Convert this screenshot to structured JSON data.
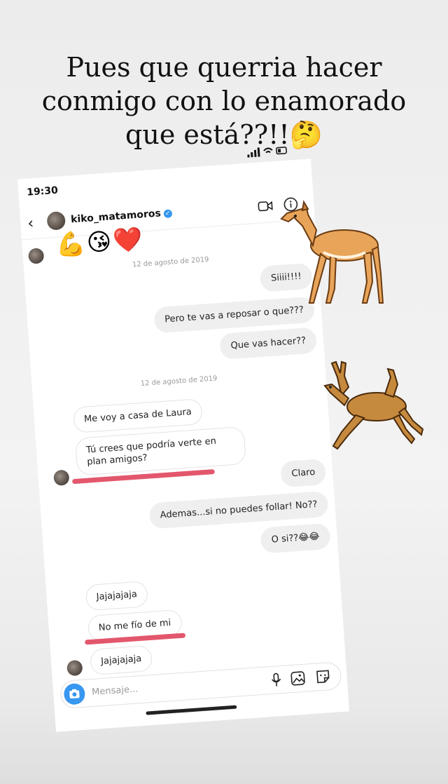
{
  "caption": {
    "line1": "Pues que querria hacer",
    "line2": "conmigo con lo enamorado",
    "line3": "que está??!!",
    "emoji": "🤔"
  },
  "status_bar": {
    "time": "19:30"
  },
  "chat_header": {
    "username": "kiko_matamoros",
    "verified_icon": "✓"
  },
  "top_emojis": "💪😘❤️",
  "date_labels": [
    "12 de agosto de 2019",
    "12 de agosto de 2019"
  ],
  "messages": [
    {
      "text": "Siiii!!!!",
      "direction": "outgoing"
    },
    {
      "text": "Pero te vas a reposar o que???",
      "direction": "outgoing"
    },
    {
      "text": "Que vas hacer??",
      "direction": "outgoing"
    },
    {
      "text": "Me voy a casa de Laura",
      "direction": "incoming"
    },
    {
      "text": "Tú crees que podría verte en plan amigos?",
      "direction": "incoming",
      "highlighted": true
    },
    {
      "text": "Claro",
      "direction": "outgoing"
    },
    {
      "text": "Ademas...si no puedes follar!  No??",
      "direction": "outgoing"
    },
    {
      "text": "O si??😂😂",
      "direction": "outgoing"
    },
    {
      "text": "Jajajajaja",
      "direction": "incoming"
    },
    {
      "text": "No me fío de mi",
      "direction": "incoming",
      "highlighted": true
    },
    {
      "text": "Jajajajaja",
      "direction": "incoming"
    }
  ],
  "composer": {
    "placeholder": "Mensaje..."
  },
  "icons": [
    "back-icon",
    "verified-icon",
    "video-call-icon",
    "info-icon",
    "camera-icon",
    "microphone-icon",
    "gallery-icon",
    "sticker-icon",
    "deer-sticker"
  ],
  "colors": {
    "highlight": "#e0455d",
    "accent": "#3897f0",
    "outgoing_bubble": "#efefef"
  }
}
